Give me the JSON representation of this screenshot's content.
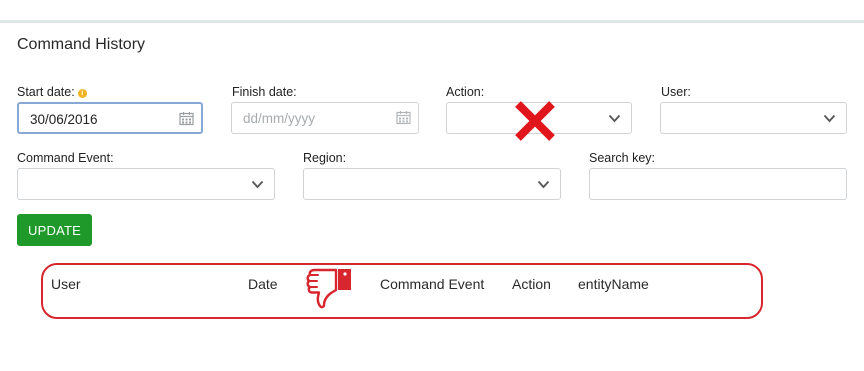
{
  "page": {
    "title": "Command History"
  },
  "filters": {
    "start_date": {
      "label": "Start date:",
      "value": "30/06/2016",
      "info_icon": "info-icon"
    },
    "finish_date": {
      "label": "Finish date:",
      "placeholder": "dd/mm/yyyy"
    },
    "action": {
      "label": "Action:",
      "value": ""
    },
    "user": {
      "label": "User:",
      "value": ""
    },
    "command_event": {
      "label": "Command Event:",
      "value": ""
    },
    "region": {
      "label": "Region:",
      "value": ""
    },
    "search_key": {
      "label": "Search key:",
      "value": ""
    }
  },
  "update_button": {
    "label": "UPDATE",
    "color": "#1f9a2a"
  },
  "table": {
    "columns": [
      "User",
      "Date",
      "Command Event",
      "Action",
      "entityName"
    ]
  },
  "annotations": {
    "cross_icon": "red-x-mark",
    "thumbs_down_icon": "thumbs-down",
    "color": "#d8262f"
  }
}
